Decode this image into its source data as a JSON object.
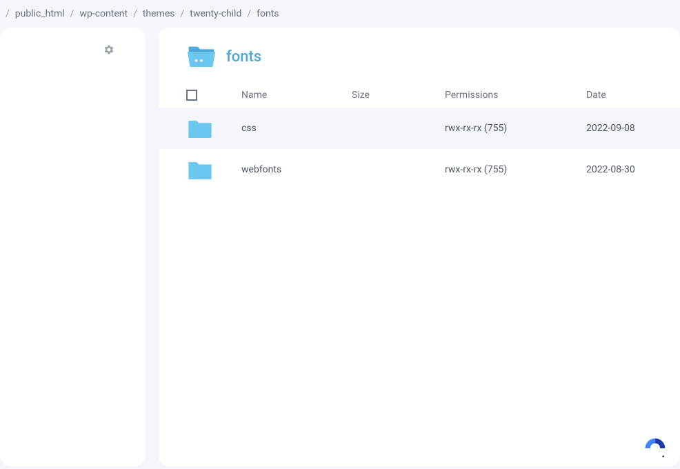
{
  "breadcrumb": {
    "items": [
      "public_html",
      "wp-content",
      "themes",
      "twenty-child",
      "fonts"
    ]
  },
  "folder": {
    "title": "fonts"
  },
  "columns": {
    "name": "Name",
    "size": "Size",
    "permissions": "Permissions",
    "date": "Date"
  },
  "rows": [
    {
      "name": "css",
      "size": "",
      "permissions": "rwx-rx-rx (755)",
      "date": "2022-09-08",
      "highlighted": true
    },
    {
      "name": "webfonts",
      "size": "",
      "permissions": "rwx-rx-rx (755)",
      "date": "2022-08-30",
      "highlighted": false
    }
  ]
}
